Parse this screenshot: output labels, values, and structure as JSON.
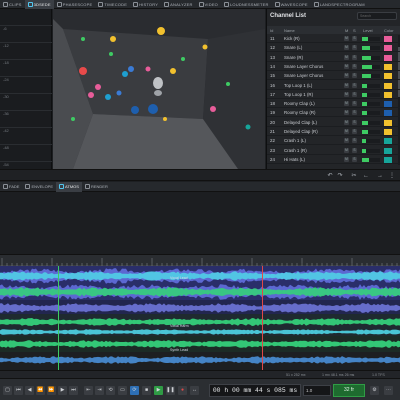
{
  "top_tabs": [
    {
      "label": "CLIPS",
      "active": false
    },
    {
      "label": "3DSEDE",
      "active": true
    },
    {
      "label": "PHASESCOPE",
      "active": false
    },
    {
      "label": "TIMECODE",
      "active": false
    },
    {
      "label": "HISTORY",
      "active": false
    },
    {
      "label": "ANALYZER",
      "active": false
    },
    {
      "label": "VIDEO",
      "active": false
    },
    {
      "label": "LOUDNESSMETER",
      "active": false
    },
    {
      "label": "WAVESCOPE",
      "active": false
    },
    {
      "label": "LANDSPECTROGRAM",
      "active": false
    }
  ],
  "meter_labels": [
    "-6",
    "-12",
    "-18",
    "-24",
    "-30",
    "-36",
    "-42",
    "-48",
    "-54"
  ],
  "channel_list": {
    "title": "Channel List",
    "search_placeholder": "Search",
    "headers": {
      "id": "Id",
      "name": "Name",
      "m": "M",
      "s": "S",
      "level": "Level",
      "color": "Color"
    },
    "rows": [
      {
        "id": "11",
        "name": "Kick (R)",
        "level": 0.35,
        "color": "#e85d9a"
      },
      {
        "id": "12",
        "name": "Snare (L)",
        "level": 0.45,
        "color": "#e85d9a"
      },
      {
        "id": "13",
        "name": "Snare (R)",
        "level": 0.5,
        "color": "#e85d9a"
      },
      {
        "id": "14",
        "name": "Snare Layer Chorus",
        "level": 0.55,
        "color": "#f2c12e"
      },
      {
        "id": "15",
        "name": "Snare Layer Chorus",
        "level": 0.5,
        "color": "#f2c12e"
      },
      {
        "id": "16",
        "name": "Top Loop 1 (L)",
        "level": 0.3,
        "color": "#f2c12e"
      },
      {
        "id": "17",
        "name": "Top Loop 1 (R)",
        "level": 0.3,
        "color": "#f2c12e"
      },
      {
        "id": "18",
        "name": "Roomy Clap (L)",
        "level": 0.25,
        "color": "#1e5fae"
      },
      {
        "id": "19",
        "name": "Roomy Clap (R)",
        "level": 0.25,
        "color": "#1e5fae"
      },
      {
        "id": "20",
        "name": "Delayed Clap (L)",
        "level": 0.35,
        "color": "#f2c12e"
      },
      {
        "id": "21",
        "name": "Delayed Clap (R)",
        "level": 0.35,
        "color": "#f2c12e"
      },
      {
        "id": "22",
        "name": "Crash 1 (L)",
        "level": 0.2,
        "color": "#17a59a"
      },
      {
        "id": "23",
        "name": "Crash 1 (R)",
        "level": 0.2,
        "color": "#17a59a"
      },
      {
        "id": "24",
        "name": "Hi Hats (L)",
        "level": 0.4,
        "color": "#17a59a"
      }
    ]
  },
  "lower_tabs": [
    {
      "label": "FADE",
      "active": false
    },
    {
      "label": "ENVELOPE",
      "active": false
    },
    {
      "label": "ATMOS",
      "active": true
    },
    {
      "label": "RENDER",
      "active": false
    }
  ],
  "track_labels": [
    "Vocal Lead",
    "Vocal Harm",
    "Synth Lead"
  ],
  "status": {
    "left": "",
    "mid": "51 x 252 mx",
    "right1": "1 mx 48.1 ms 26 ms",
    "right2": "1.0 TFS"
  },
  "transport": {
    "timecode": "00 h 00 mm 44 s 085 ms",
    "speed": "1.0",
    "rate": "32 fr"
  },
  "colors": {
    "accent": "#52c7f0",
    "wave_blue": "#5f6bd8",
    "wave_green": "#35d07a",
    "wave_cyan": "#4fd6e8"
  }
}
